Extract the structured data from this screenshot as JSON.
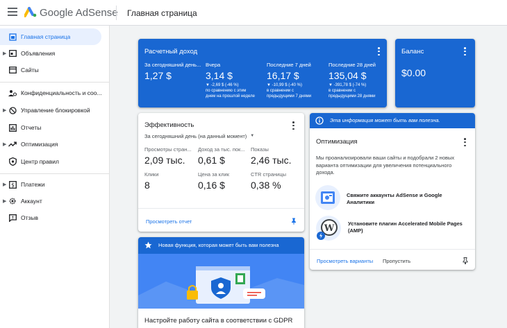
{
  "header": {
    "logo_text": "Google AdSense",
    "page_title": "Главная страница"
  },
  "sidebar": {
    "items": [
      {
        "label": "Главная страница",
        "icon": "home-icon"
      },
      {
        "label": "Объявления",
        "icon": "ads-icon"
      },
      {
        "label": "Сайты",
        "icon": "sites-icon"
      },
      {
        "label": "Конфиденциальность и соо...",
        "icon": "privacy-icon"
      },
      {
        "label": "Управление блокировкой",
        "icon": "block-icon"
      },
      {
        "label": "Отчеты",
        "icon": "reports-icon"
      },
      {
        "label": "Оптимизация",
        "icon": "optimization-icon"
      },
      {
        "label": "Центр правил",
        "icon": "policy-icon"
      },
      {
        "label": "Платежи",
        "icon": "payments-icon"
      },
      {
        "label": "Аккаунт",
        "icon": "account-gear-icon"
      },
      {
        "label": "Отзыв",
        "icon": "feedback-icon"
      }
    ]
  },
  "earnings": {
    "title": "Расчетный доход",
    "metrics": [
      {
        "label": "За сегодняшний день...",
        "value": "1,27 $",
        "sub": ""
      },
      {
        "label": "Вчера",
        "value": "3,14 $",
        "sub": "▼ -2,69 $ (-46 %)\nпо сравнению с этим\nднем на прошлой неделе"
      },
      {
        "label": "Последние 7 дней",
        "value": "16,17 $",
        "sub": "▼ -10,99 $ (-40 %)\nв сравнении с\nпредыдущими 7 днями"
      },
      {
        "label": "Последние 28 дней",
        "value": "135,04 $",
        "sub": "▼ -391,78 $ (-74 %)\nв сравнении с\nпредыдущими 28 днями"
      }
    ]
  },
  "balance": {
    "title": "Баланс",
    "value": "$0.00"
  },
  "performance": {
    "title": "Эффективность",
    "period": "За сегодняшний день (на данный момент)",
    "metrics": [
      {
        "label": "Просмотры стран...",
        "value": "2,09 тыс."
      },
      {
        "label": "Доход за тыс. пок...",
        "value": "0,61 $"
      },
      {
        "label": "Показы",
        "value": "2,46 тыс."
      },
      {
        "label": "Клики",
        "value": "8"
      },
      {
        "label": "Цена за клик",
        "value": "0,16 $"
      },
      {
        "label": "CTR страницы",
        "value": "0,38 %"
      }
    ],
    "link": "Просмотреть отчет"
  },
  "info_banner": {
    "text": "Эта информация может быть вам полезна."
  },
  "optimization": {
    "title": "Оптимизация",
    "description": "Мы проанализировали ваши сайты и подобрали 2 новых варианта оптимизации для увеличения потенциального дохода.",
    "items": [
      {
        "text": "Свяжите аккаунты AdSense и Google Аналитики"
      },
      {
        "text": "Установите плагин Accelerated Mobile Pages (AMP)"
      }
    ],
    "view_link": "Просмотреть варианты",
    "skip_link": "Пропустить"
  },
  "feature": {
    "banner": "Новая функция, которая может быть вам полезна",
    "title": "Настройте работу сайта в соответствии с GDPR"
  },
  "colors": {
    "brand_blue": "#1967d2",
    "link_blue": "#1a73e8",
    "logo_yellow": "#fbbc04",
    "logo_green": "#34a853",
    "logo_blue": "#4285f4"
  }
}
